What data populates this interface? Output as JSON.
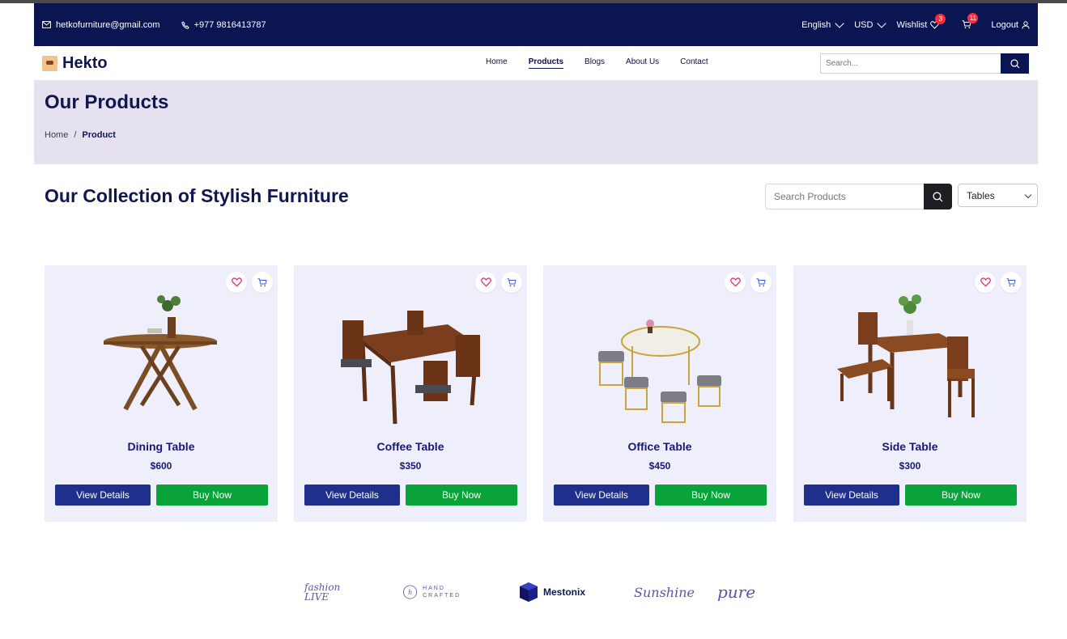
{
  "topbar": {
    "email": "hetkofurniture@gmail.com",
    "phone": "+977 9816413787",
    "language": "English",
    "currency": "USD",
    "wishlist_label": "Wishlist",
    "wishlist_count": "3",
    "cart_count": "11",
    "logout_label": "Logout"
  },
  "navbar": {
    "brand": "Hekto",
    "links": [
      "Home",
      "Products",
      "Blogs",
      "About Us",
      "Contact"
    ],
    "active_link": "Products",
    "search_placeholder": "Search..."
  },
  "hero": {
    "title": "Our Products",
    "breadcrumb": [
      "Home",
      "Product"
    ],
    "separator": "/"
  },
  "collection": {
    "title": "Our Collection of Stylish Furniture",
    "search_placeholder": "Search Products",
    "filter_value": "Tables"
  },
  "products": [
    {
      "name": "Dining Table",
      "price": "$600",
      "view_label": "View Details",
      "buy_label": "Buy Now"
    },
    {
      "name": "Coffee Table",
      "price": "$350",
      "view_label": "View Details",
      "buy_label": "Buy Now"
    },
    {
      "name": "Office Table",
      "price": "$450",
      "view_label": "View Details",
      "buy_label": "Buy Now"
    },
    {
      "name": "Side Table",
      "price": "$300",
      "view_label": "View Details",
      "buy_label": "Buy Now"
    }
  ],
  "brands": [
    "fashion LIVE",
    "HAND CRAFTED",
    "Mestonix",
    "Sunshine",
    "pure"
  ],
  "colors": {
    "topbar_bg": "#0b1551",
    "hero_bg": "#e5e1ef",
    "card_bg": "#efeffc",
    "view_button": "#1f2f8c",
    "buy_button": "#0aa33a",
    "badge": "#ff2a3a",
    "heart": "#e0306d"
  }
}
